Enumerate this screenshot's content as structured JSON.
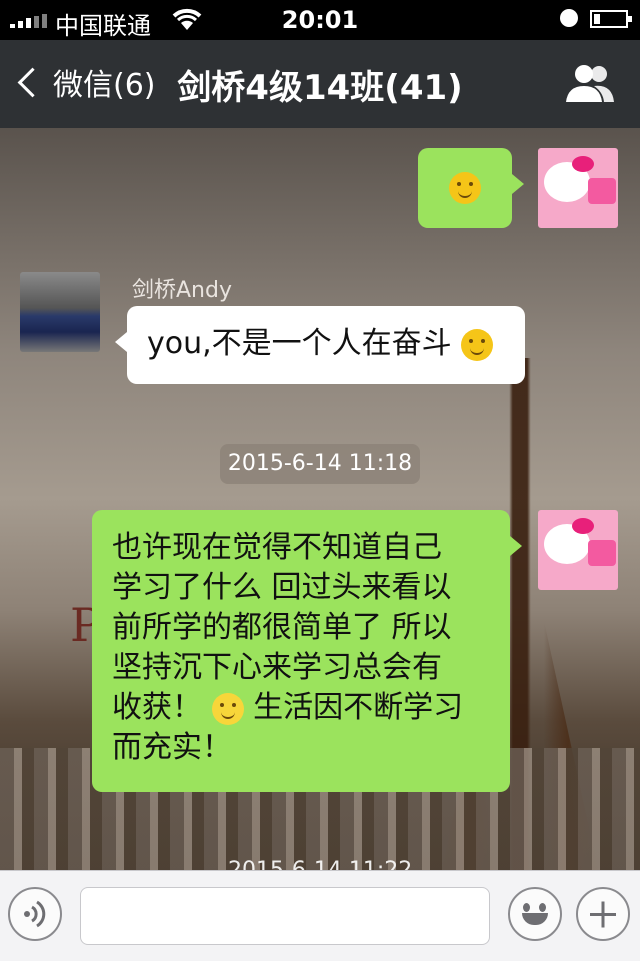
{
  "status_bar": {
    "carrier": "中国联通",
    "time": "20:01"
  },
  "nav": {
    "back_label": "微信(6)",
    "title": "剑桥4级14班(41)"
  },
  "messages": {
    "m2_sender": "剑桥Andy",
    "m2_text": "you,不是一个人在奋斗",
    "timestamp1": "2015-6-14 11:18",
    "m3_lines": [
      "也许现在觉得不知道自己",
      "学习了什么 回过头来看以",
      "前所学的都很简单了 所以",
      "坚持沉下心来学习总会有"
    ],
    "m3_line5_a": "收获！",
    "m3_line5_b": " 生活因不断学习",
    "m3_line6": "而充实！",
    "timestamp2_partial": "2015-6-14 11:22"
  },
  "icons": {
    "back": "chevron-left-icon",
    "group": "people-icon",
    "voice": "voice-icon",
    "emoji": "smiley-icon",
    "more": "plus-icon"
  },
  "colors": {
    "nav_bg": "#2e3134",
    "bubble_green": "#9be35d",
    "bubble_white": "#ffffff"
  }
}
